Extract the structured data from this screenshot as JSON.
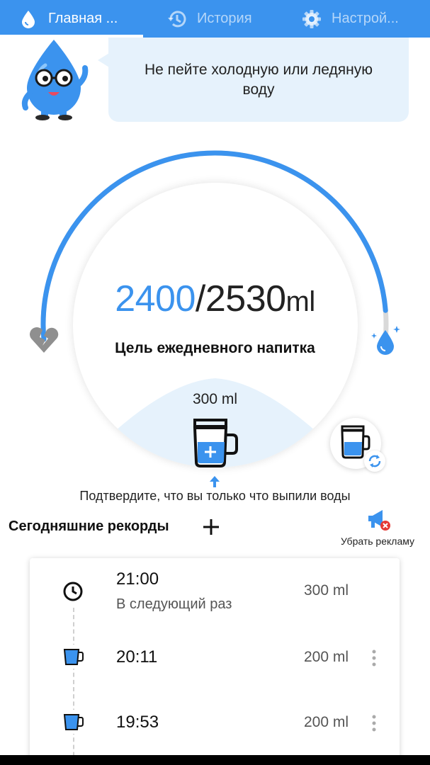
{
  "tabs": [
    {
      "label": "Главная ...",
      "icon": "water-drop-icon",
      "active": true
    },
    {
      "label": "История",
      "icon": "history-icon",
      "active": false
    },
    {
      "label": "Настрой...",
      "icon": "gear-icon",
      "active": false
    }
  ],
  "tip": {
    "text": "Не пейте холодную или ледяную воду"
  },
  "progress": {
    "current": "2400",
    "separator": "/",
    "goal": "2530",
    "unit": "ml",
    "goal_label": "Цель ежедневного напитка",
    "fraction": 0.949
  },
  "cup": {
    "amount": "300 ml"
  },
  "confirm_text": "Подтвердите, что вы только что выпили воды",
  "records": {
    "title": "Сегодняшние рекорды",
    "items": [
      {
        "time": "21:00",
        "subtitle": "В следующий раз",
        "amount": "300 ml",
        "icon": "clock-icon"
      },
      {
        "time": "20:11",
        "amount": "200 ml",
        "icon": "cup-icon"
      },
      {
        "time": "19:53",
        "amount": "200 ml",
        "icon": "cup-icon"
      }
    ]
  },
  "remove_ads": {
    "label": "Убрать рекламу"
  },
  "colors": {
    "accent": "#3b93ee",
    "light": "#e6f2fc",
    "track": "#d9d9d9"
  }
}
